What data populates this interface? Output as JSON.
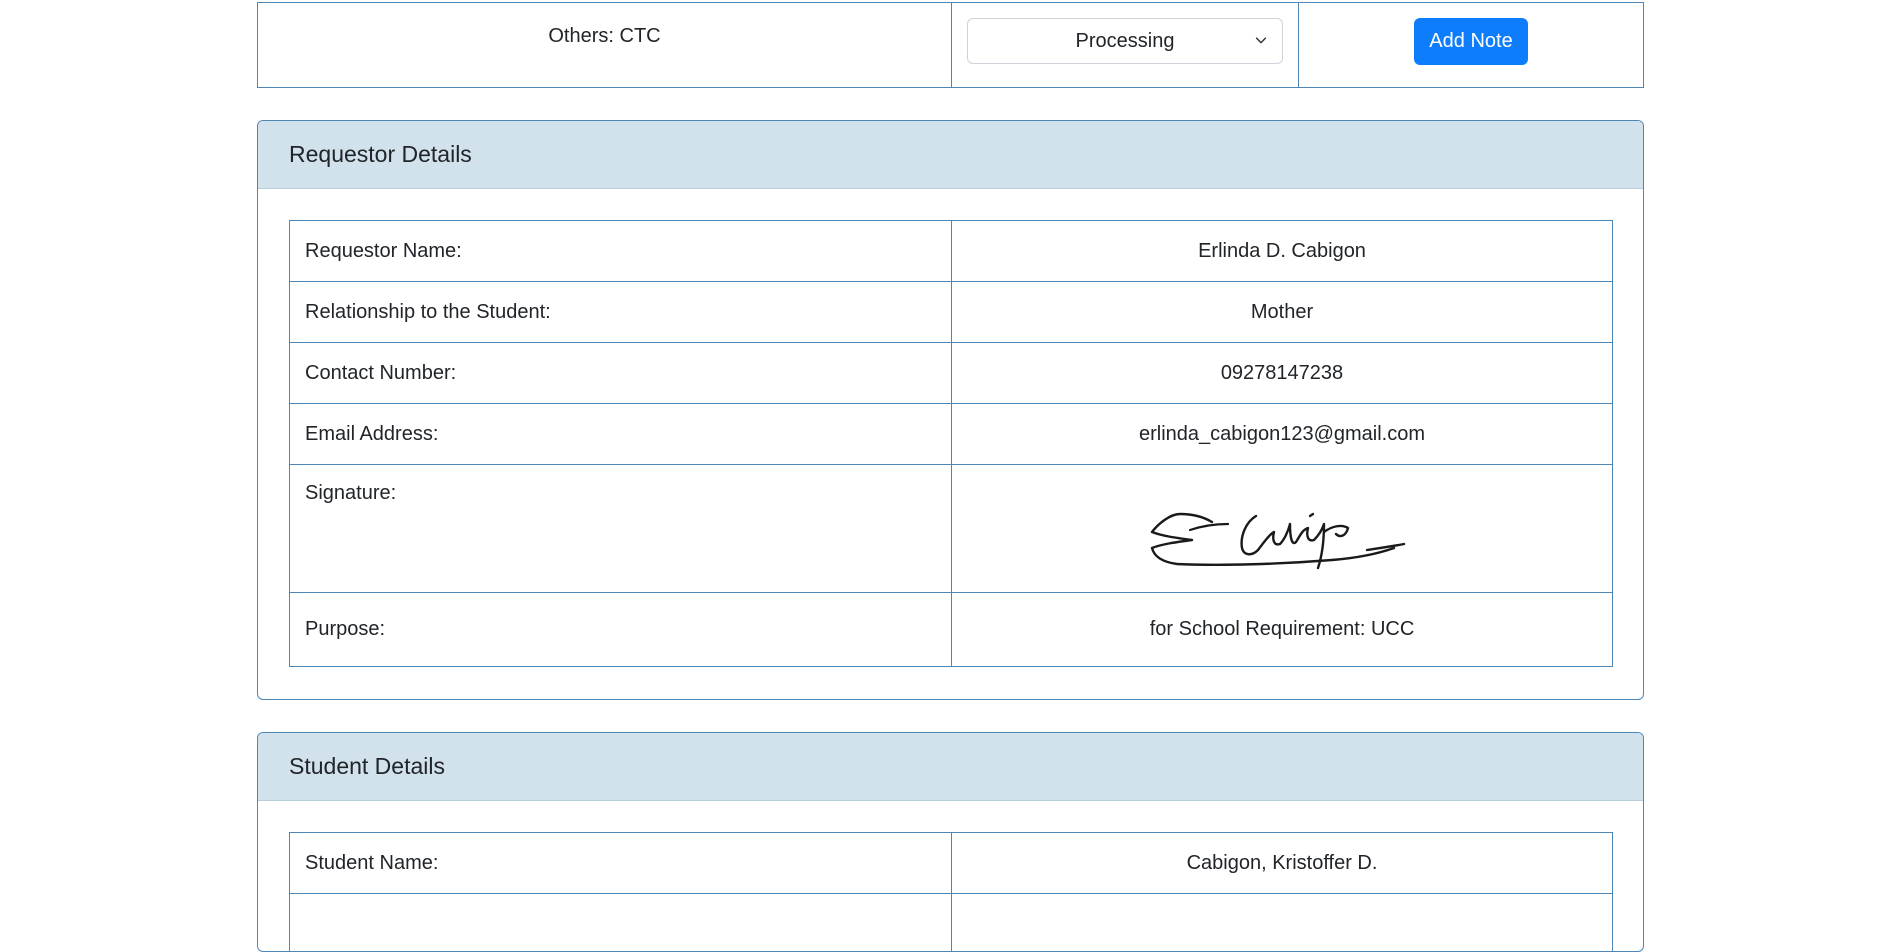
{
  "request_row": {
    "document": "Others: CTC",
    "status": {
      "selected": "Processing"
    },
    "action_label": "Add Note"
  },
  "requestor": {
    "title": "Requestor Details",
    "rows": [
      {
        "label": "Requestor Name:",
        "value": "Erlinda D. Cabigon"
      },
      {
        "label": "Relationship to the Student:",
        "value": "Mother"
      },
      {
        "label": "Contact Number:",
        "value": "09278147238"
      },
      {
        "label": "Email Address:",
        "value": "erlinda_cabigon123@gmail.com"
      },
      {
        "label": "Signature:",
        "value": "Cabigon"
      },
      {
        "label": "Purpose:",
        "value": "for School Requirement: UCC"
      }
    ]
  },
  "student": {
    "title": "Student Details",
    "rows": [
      {
        "label": "Student Name:",
        "value": "Cabigon, Kristoffer D."
      },
      {
        "label": "",
        "value": ""
      }
    ]
  },
  "colors": {
    "border": "#4f86b8",
    "card_header_bg": "#d2e2ec",
    "primary_button": "#0d7dfb"
  },
  "icons": {
    "select_arrow": "chevron-down-icon",
    "signature": "signature-image"
  }
}
